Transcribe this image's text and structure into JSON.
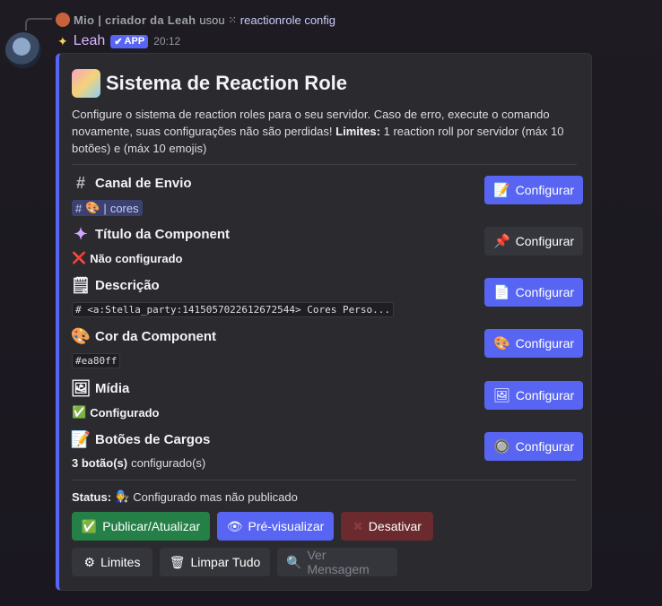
{
  "reply": {
    "username": "Mio | criador da Leah",
    "used_text": "usou",
    "command": "reactionrole config"
  },
  "message": {
    "author": "Leah",
    "badge": "APP",
    "time": "20:12"
  },
  "embed": {
    "title": "Sistema de Reaction Role",
    "description_main": "Configure o sistema de reaction roles para o seu servidor. Caso de erro, execute o comando novamente, suas configurações não são perdidas! ",
    "limits_label": "Limites:",
    "limits_text": " 1 reaction roll por servidor (máx 10 botões) e (máx 10 emojis)",
    "accent_color": "#5865f2",
    "sections": [
      {
        "icon": "hash-icon",
        "title": "Canal de Envio",
        "channel_hash": "#",
        "channel_name": "cores",
        "button": "Configurar"
      },
      {
        "icon": "sparkles-icon",
        "title": "Título da Component",
        "value_icon": "❌",
        "value": "Não configurado",
        "button": "Configurar"
      },
      {
        "icon": "document-icon",
        "title": "Descrição",
        "value": "# <a:Stella_party:1415057022612672544> Cores Perso...",
        "button": "Configurar"
      },
      {
        "icon": "palette-icon",
        "title": "Cor da Component",
        "value": "#ea80ff",
        "button": "Configurar"
      },
      {
        "icon": "image-icon",
        "title": "Mídia",
        "value_icon": "✅",
        "value": "Configurado",
        "button": "Configurar"
      },
      {
        "icon": "pencil-icon",
        "title": "Botões de Cargos",
        "value_bold": "3 botão(s)",
        "value_rest": " configurado(s)",
        "button": "Configurar"
      }
    ],
    "status_label": "Status:",
    "status_text": "Configurado mas não publicado",
    "actions": {
      "publish": "Publicar/Atualizar",
      "preview": "Pré-visualizar",
      "deactivate": "Desativar",
      "limits": "Limites",
      "clear_all": "Limpar Tudo",
      "view_message": "Ver Mensagem"
    }
  }
}
